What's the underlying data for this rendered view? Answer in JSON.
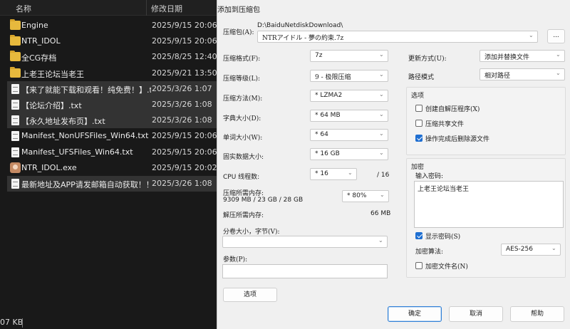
{
  "explorer": {
    "header": {
      "name": "名称",
      "date": "修改日期"
    },
    "files": [
      {
        "name": "Engine",
        "date": "2025/9/15 20:06",
        "type": "folder",
        "selected": false
      },
      {
        "name": "NTR_IDOL",
        "date": "2025/9/15 20:06",
        "type": "folder",
        "selected": false
      },
      {
        "name": "全CG存档",
        "date": "2025/8/25 12:40",
        "type": "folder",
        "selected": false
      },
      {
        "name": "上老王论坛当老王",
        "date": "2025/9/21 13:50",
        "type": "folder",
        "selected": false
      },
      {
        "name": "【来了就能下载和观看！纯免费！】.txt",
        "date": "2025/3/26 1:07",
        "type": "txt",
        "selected": true
      },
      {
        "name": "【论坛介绍】.txt",
        "date": "2025/3/26 1:08",
        "type": "txt",
        "selected": true
      },
      {
        "name": "【永久地址发布页】.txt",
        "date": "2025/3/26 1:08",
        "type": "txt",
        "selected": true
      },
      {
        "name": "Manifest_NonUFSFiles_Win64.txt",
        "date": "2025/9/15 20:06",
        "type": "txt",
        "selected": false
      },
      {
        "name": "Manifest_UFSFiles_Win64.txt",
        "date": "2025/9/15 20:06",
        "type": "txt",
        "selected": false
      },
      {
        "name": "NTR_IDOL.exe",
        "date": "2025/9/15 20:02",
        "type": "exe",
        "selected": false
      },
      {
        "name": "最新地址及APP请发邮箱自动获取！！！...",
        "date": "2025/3/26 1:08",
        "type": "txt",
        "selected": true
      }
    ],
    "status_size": "07 KB"
  },
  "dialog": {
    "title": "添加到压缩包",
    "archive_label": "压缩包(A):",
    "archive_dir": "D:\\BaiduNetdiskDownload\\",
    "archive_name": "NTRアイドル - 夢の約束.7z",
    "browse_label": "...",
    "format_label": "压缩格式(F):",
    "format_value": "7z",
    "level_label": "压缩等级(L):",
    "level_value": "9 - 极限压缩",
    "method_label": "压缩方法(M):",
    "method_value": "* LZMA2",
    "dict_label": "字典大小(D):",
    "dict_value": "* 64 MB",
    "word_label": "单词大小(W):",
    "word_value": "* 64",
    "solid_label": "固实数据大小:",
    "solid_value": "* 16 GB",
    "threads_label": "CPU 线程数:",
    "threads_value": "* 16",
    "threads_total": "/ 16",
    "mem_comp_label": "压缩所需内存:",
    "mem_comp_detail": "9309 MB / 23 GB / 28 GB",
    "mem_comp_value": "* 80%",
    "mem_decomp_label": "解压所需内存:",
    "mem_decomp_value": "66 MB",
    "volume_label": "分卷大小，字节(V):",
    "volume_value": "",
    "params_label": "参数(P):",
    "params_value": "",
    "options_button": "选项",
    "update_label": "更新方式(U):",
    "update_value": "添加并替换文件",
    "path_label": "路径模式",
    "path_value": "相对路径",
    "options_group": "选项",
    "opt_sfx": "创建自解压程序(X)",
    "opt_shared": "压缩共享文件",
    "opt_delete": "操作完成后删除源文件",
    "encryption_group": "加密",
    "password_label": "输入密码:",
    "password_value": "上老王论坛当老王",
    "show_password": "显示密码(S)",
    "enc_method_label": "加密算法:",
    "enc_method_value": "AES-256",
    "encrypt_names": "加密文件名(N)",
    "ok": "确定",
    "cancel": "取消",
    "help": "帮助",
    "checkbox_states": {
      "sfx": false,
      "shared": false,
      "delete": true,
      "show_password": true,
      "encrypt_names": false
    }
  }
}
